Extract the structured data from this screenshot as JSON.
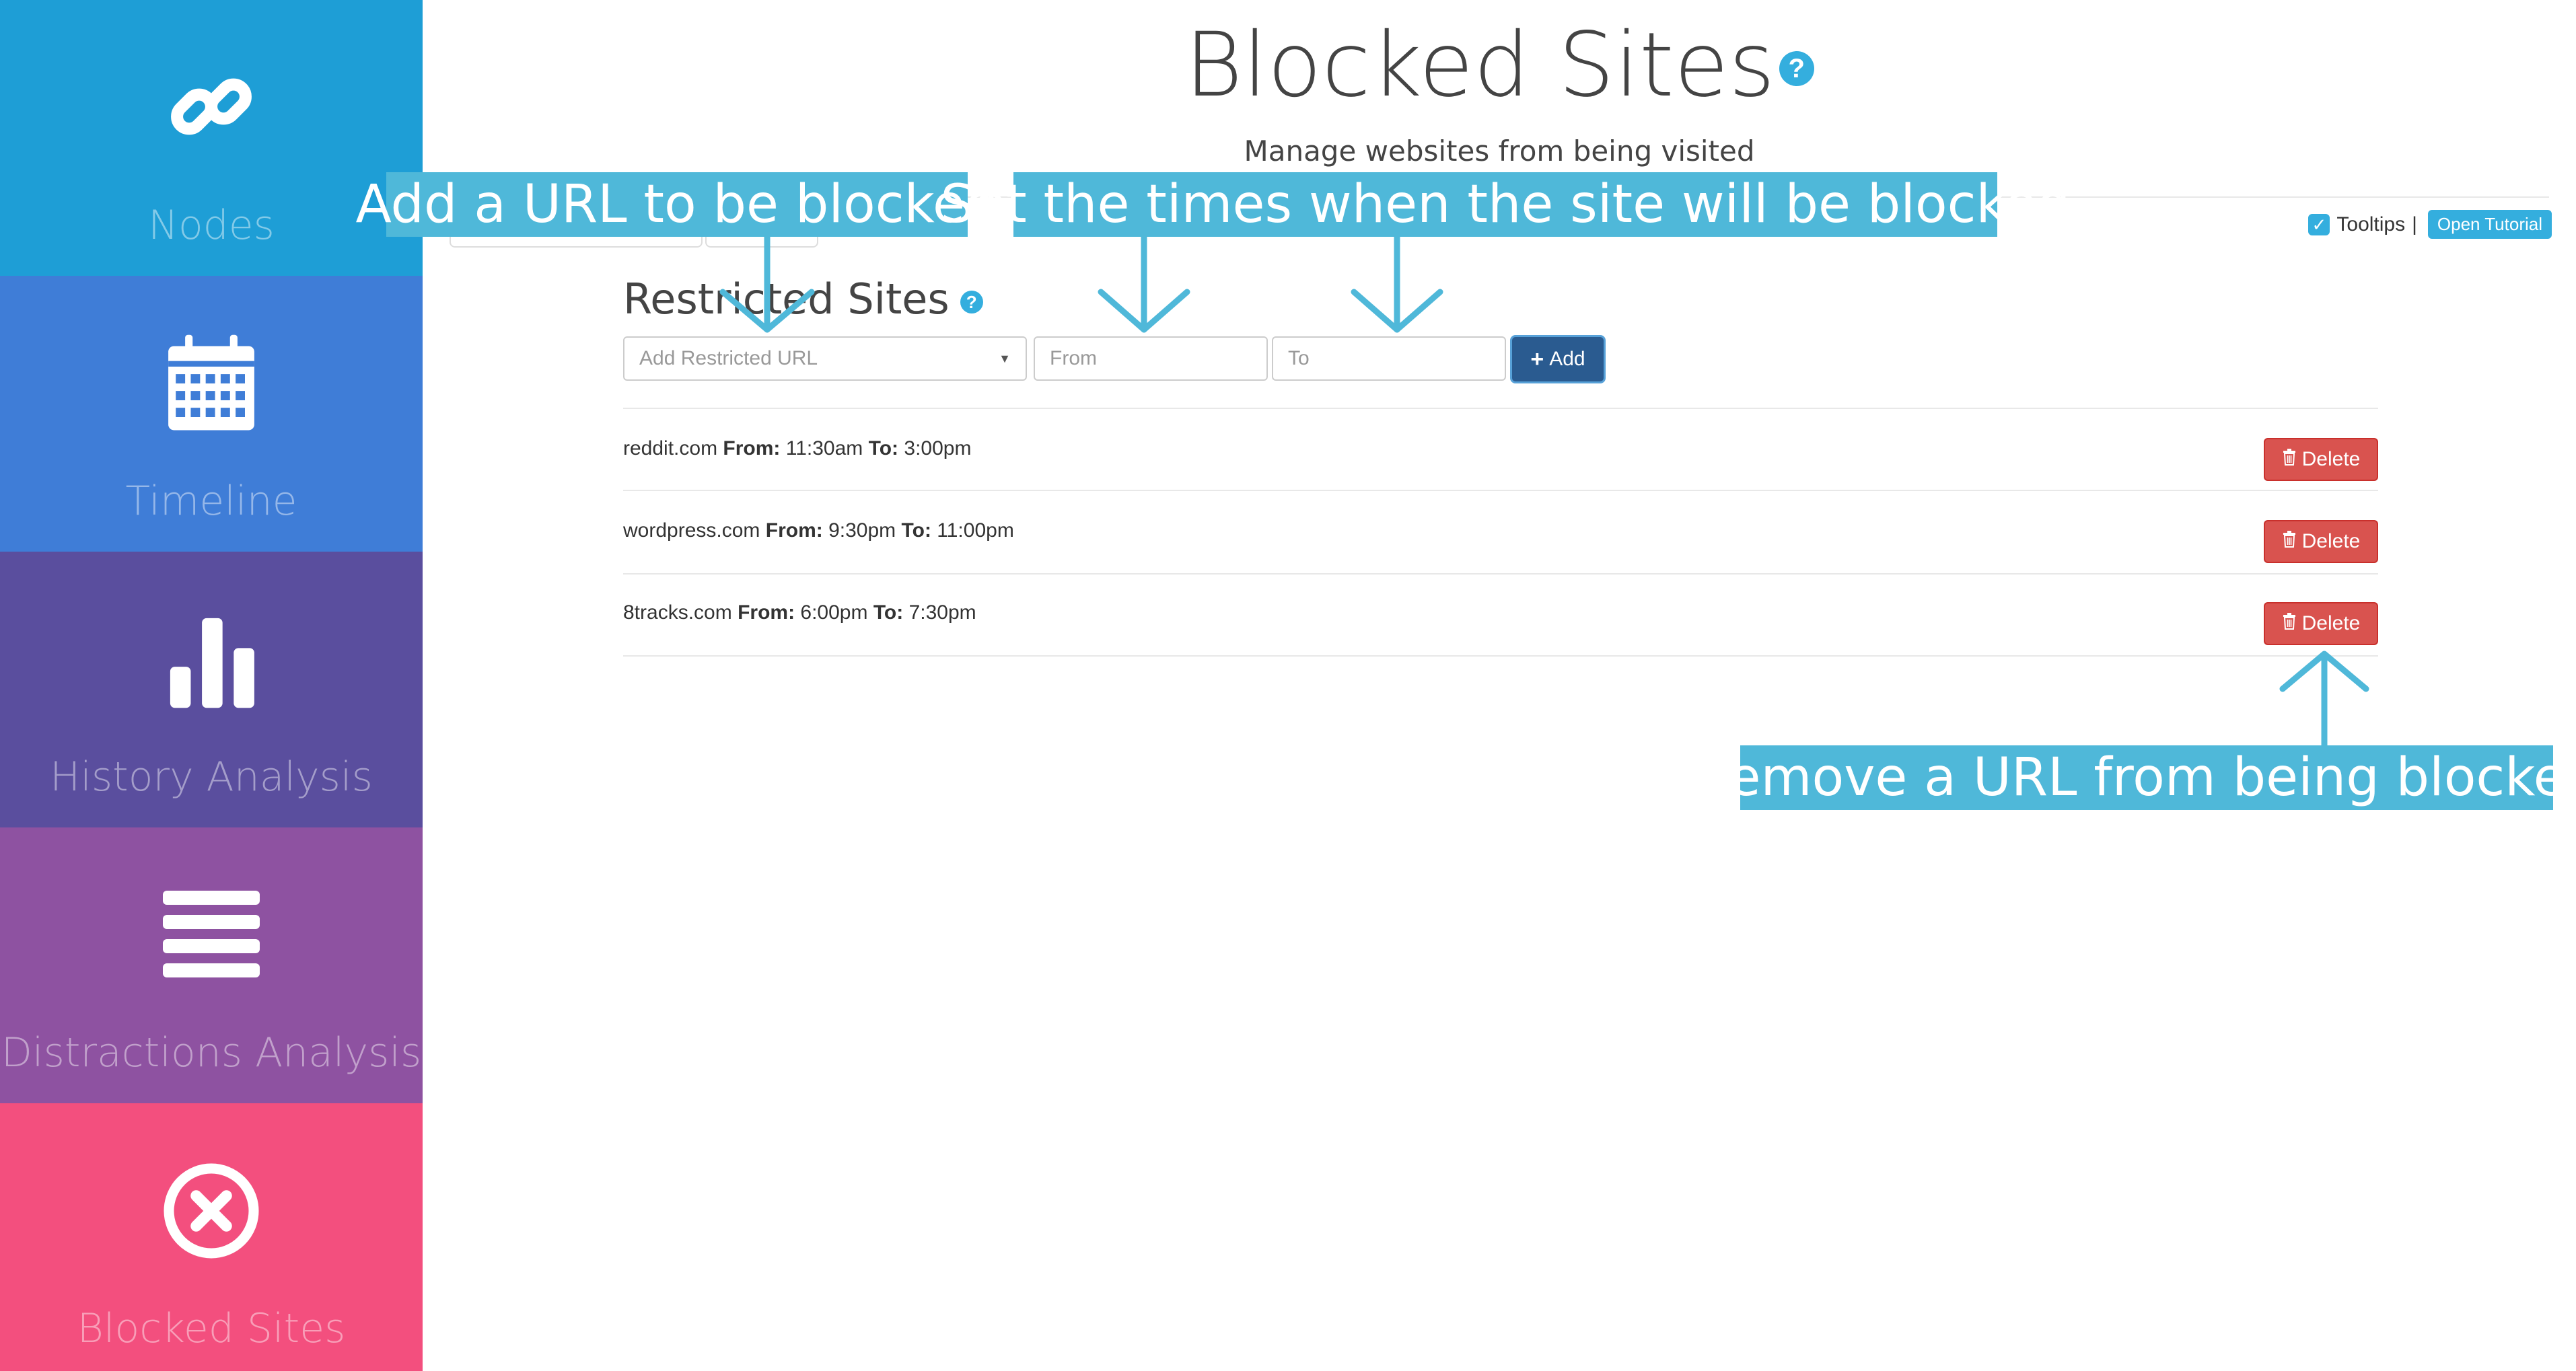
{
  "sidebar": {
    "items": [
      {
        "label": "Nodes",
        "icon": "link-icon"
      },
      {
        "label": "Timeline",
        "icon": "calendar-icon"
      },
      {
        "label": "History Analysis",
        "icon": "bar-chart-icon"
      },
      {
        "label": "Distractions Analysis",
        "icon": "list-icon"
      },
      {
        "label": "Blocked Sites",
        "icon": "close-circle-icon"
      }
    ]
  },
  "header": {
    "title": "Blocked Sites",
    "help": "?",
    "subtitle": "Manage websites from being visited",
    "tooltips_label": "Tooltips",
    "separator": "|",
    "tutorial_label": "Open Tutorial"
  },
  "restricted": {
    "title": "Restricted Sites",
    "help": "?",
    "url_placeholder": "Add Restricted URL",
    "from_placeholder": "From",
    "to_placeholder": "To",
    "add_label": "Add",
    "rows": [
      {
        "site": "reddit.com",
        "from_label": "From:",
        "from": "11:30am",
        "to_label": "To:",
        "to": "3:00pm",
        "delete_label": "Delete"
      },
      {
        "site": "wordpress.com",
        "from_label": "From:",
        "from": "9:30pm",
        "to_label": "To:",
        "to": "11:00pm",
        "delete_label": "Delete"
      },
      {
        "site": "8tracks.com",
        "from_label": "From:",
        "from": "6:00pm",
        "to_label": "To:",
        "to": "7:30pm",
        "delete_label": "Delete"
      }
    ]
  },
  "annotations": {
    "add_url": "Add a URL to be blocked",
    "set_times": "Set the times when the site will be blocked",
    "remove_url": "Remove a URL from being blocked"
  },
  "colors": {
    "nodes": "#1e9ed6",
    "timeline": "#3f7dd7",
    "history": "#5a4e9e",
    "distractions": "#8e52a1",
    "blocked": "#f34f7e",
    "accent": "#34aede",
    "delete": "#d9534f",
    "add": "#2a5b90"
  }
}
